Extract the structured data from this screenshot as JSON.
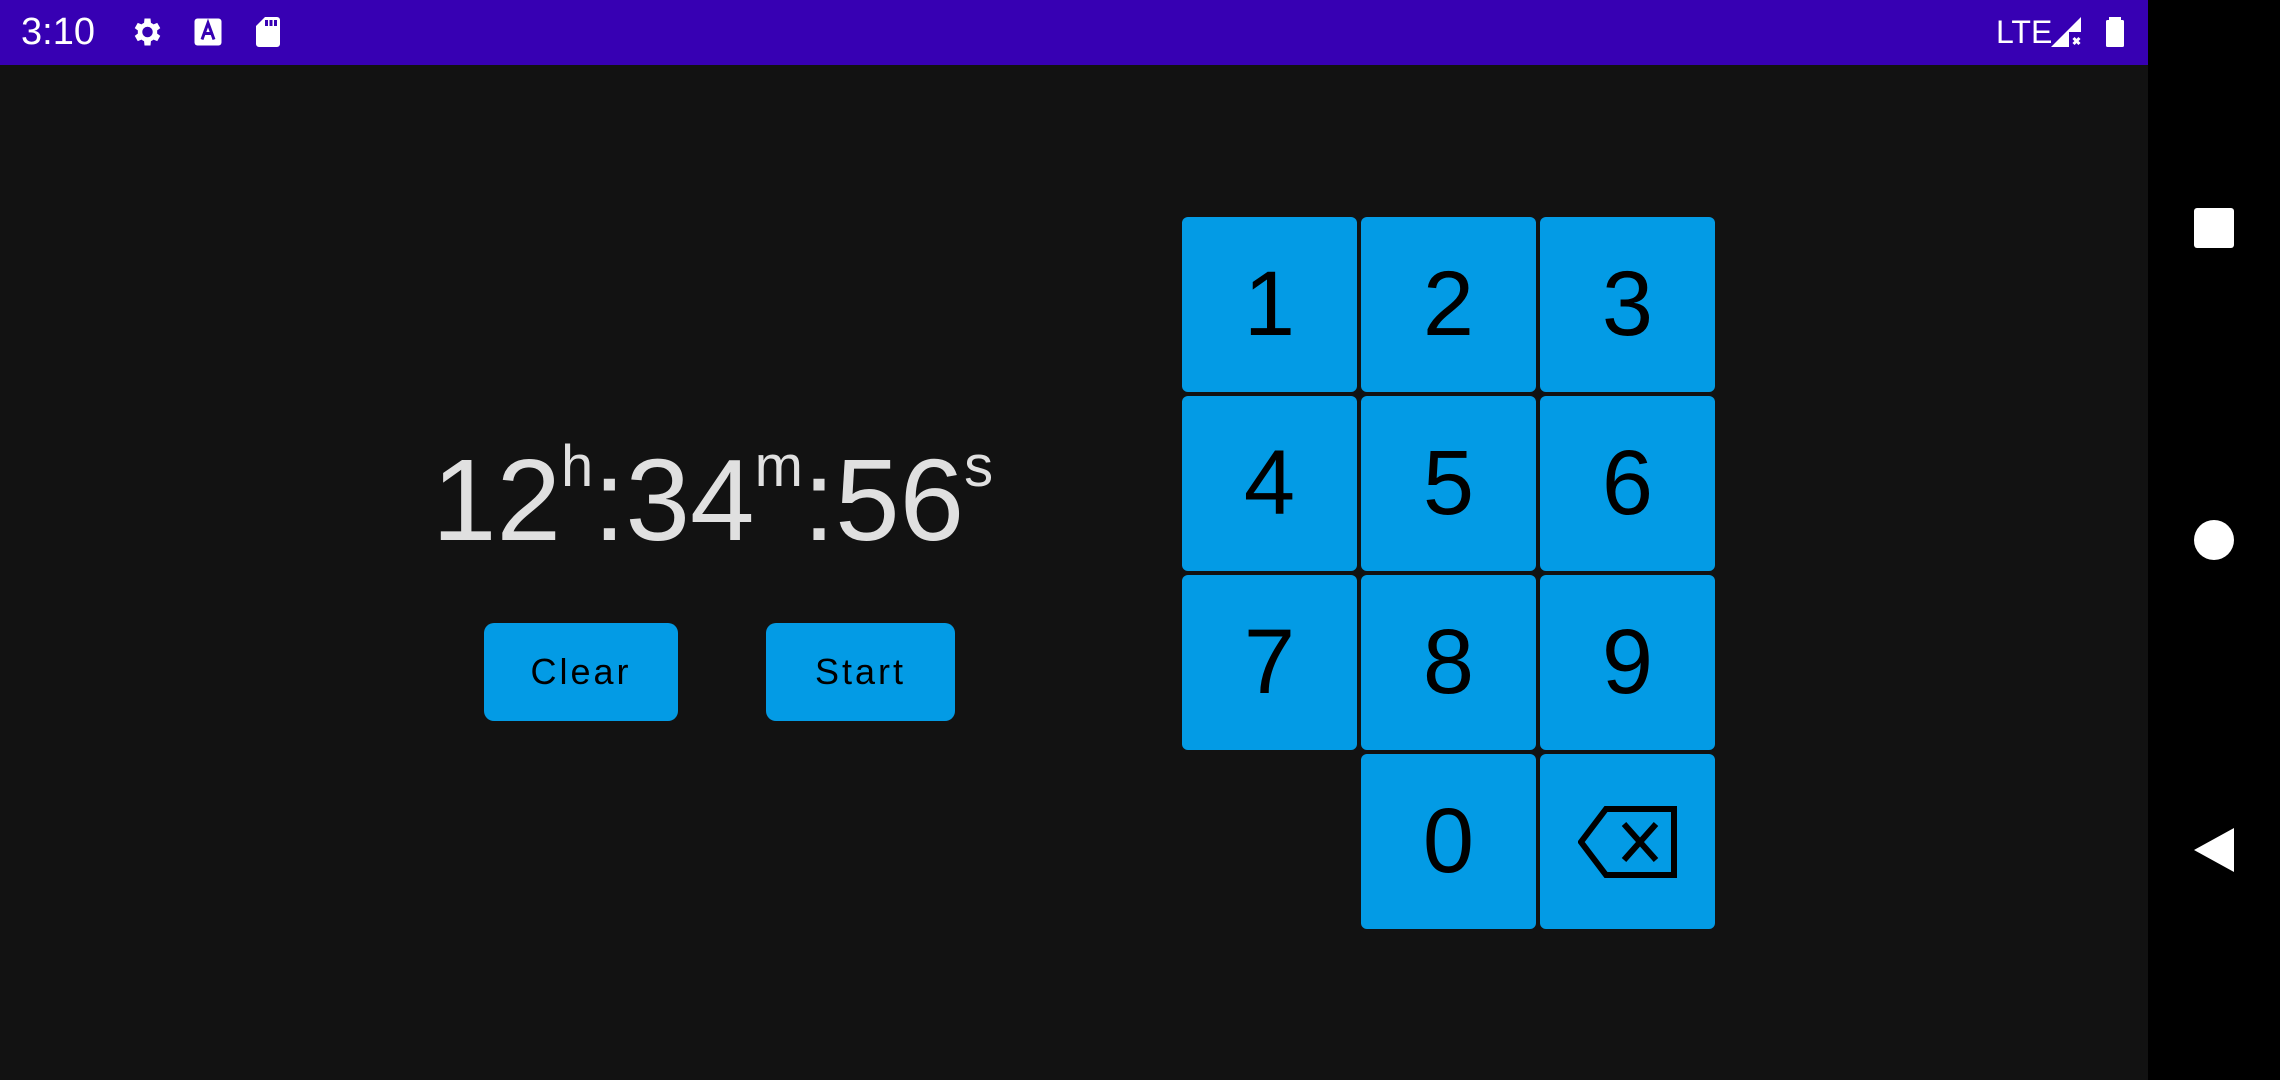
{
  "status_bar": {
    "time": "3:10",
    "network": "LTE",
    "icons": [
      "settings-icon",
      "font-a-icon",
      "sd-card-icon",
      "signal-icon",
      "battery-icon"
    ],
    "background": "#3700b3"
  },
  "timer": {
    "hours": "12",
    "hours_unit": "h",
    "sep1": ":",
    "minutes": "34",
    "minutes_unit": "m",
    "sep2": ":",
    "seconds": "56",
    "seconds_unit": "s"
  },
  "buttons": {
    "clear_label": "Clear",
    "start_label": "Start"
  },
  "keypad": {
    "keys": [
      "1",
      "2",
      "3",
      "4",
      "5",
      "6",
      "7",
      "8",
      "9",
      "0"
    ],
    "backspace_icon": "backspace-icon",
    "key_color": "#039be5"
  },
  "nav_bar": {
    "icons": [
      "recents-icon",
      "home-icon",
      "back-icon"
    ]
  },
  "colors": {
    "background": "#121212",
    "accent": "#039be5",
    "text": "#e0e0e0"
  }
}
